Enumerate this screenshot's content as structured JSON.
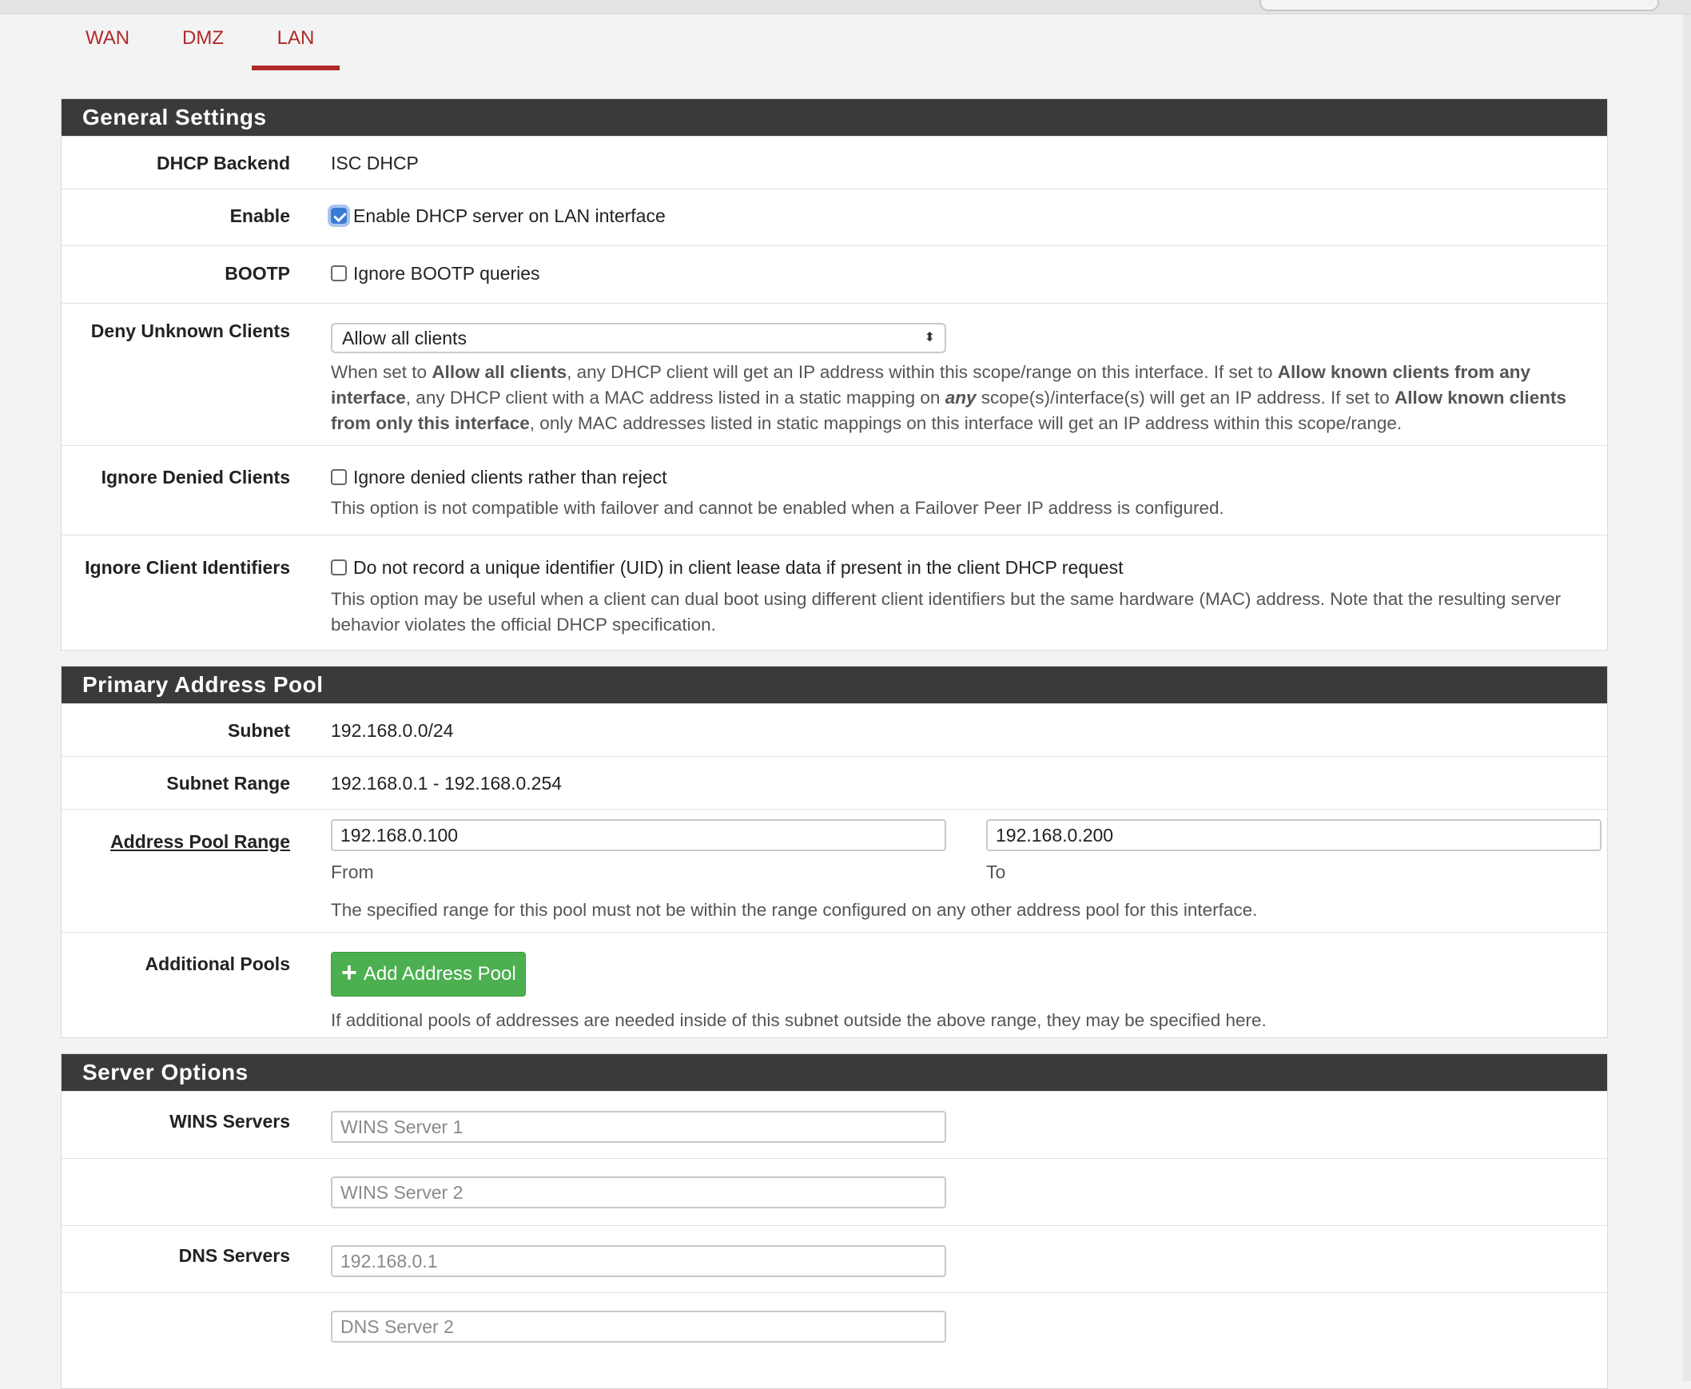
{
  "tabs": [
    {
      "label": "WAN",
      "active": false
    },
    {
      "label": "DMZ",
      "active": false
    },
    {
      "label": "LAN",
      "active": true
    }
  ],
  "colors": {
    "accent": "#b02a2a",
    "panel_header": "#3a3a3a",
    "button_green": "#4caf50",
    "checkbox_on": "#3a7bd5"
  },
  "general": {
    "title": "General Settings",
    "dhcp_backend": {
      "label": "DHCP Backend",
      "value": "ISC DHCP"
    },
    "enable": {
      "label": "Enable",
      "text": "Enable DHCP server on LAN interface",
      "checked": true
    },
    "bootp": {
      "label": "BOOTP",
      "text": "Ignore BOOTP queries",
      "checked": false
    },
    "deny_unknown": {
      "label": "Deny Unknown Clients",
      "selected": "Allow all clients",
      "help_parts": [
        "When set to ",
        "Allow all clients",
        ", any DHCP client will get an IP address within this scope/range on this interface. If set to ",
        "Allow known clients from any interface",
        ", any DHCP client with a MAC address listed in a static mapping on ",
        "any",
        " scope(s)/interface(s) will get an IP address. If set to ",
        "Allow known clients from only this interface",
        ", only MAC addresses listed in static mappings on this interface will get an IP address within this scope/range."
      ]
    },
    "ignore_denied": {
      "label": "Ignore Denied Clients",
      "text": "Ignore denied clients rather than reject",
      "checked": false,
      "help": "This option is not compatible with failover and cannot be enabled when a Failover Peer IP address is configured."
    },
    "ignore_client_ids": {
      "label": "Ignore Client Identifiers",
      "text": "Do not record a unique identifier (UID) in client lease data if present in the client DHCP request",
      "checked": false,
      "help": "This option may be useful when a client can dual boot using different client identifiers but the same hardware (MAC) address. Note that the resulting server behavior violates the official DHCP specification."
    }
  },
  "pool": {
    "title": "Primary Address Pool",
    "subnet": {
      "label": "Subnet",
      "value": "192.168.0.0/24"
    },
    "subnet_range": {
      "label": "Subnet Range",
      "value": "192.168.0.1 - 192.168.0.254"
    },
    "range": {
      "label": "Address Pool Range",
      "from_value": "192.168.0.100",
      "from_label": "From",
      "to_value": "192.168.0.200",
      "to_label": "To",
      "help": "The specified range for this pool must not be within the range configured on any other address pool for this interface."
    },
    "additional": {
      "label": "Additional Pools",
      "button": "Add Address Pool",
      "help": "If additional pools of addresses are needed inside of this subnet outside the above range, they may be specified here."
    }
  },
  "server": {
    "title": "Server Options",
    "wins": {
      "label": "WINS Servers",
      "placeholder1": "WINS Server 1",
      "placeholder2": "WINS Server 2"
    },
    "dns": {
      "label": "DNS Servers",
      "placeholder1": "192.168.0.1",
      "placeholder2": "DNS Server 2"
    }
  }
}
